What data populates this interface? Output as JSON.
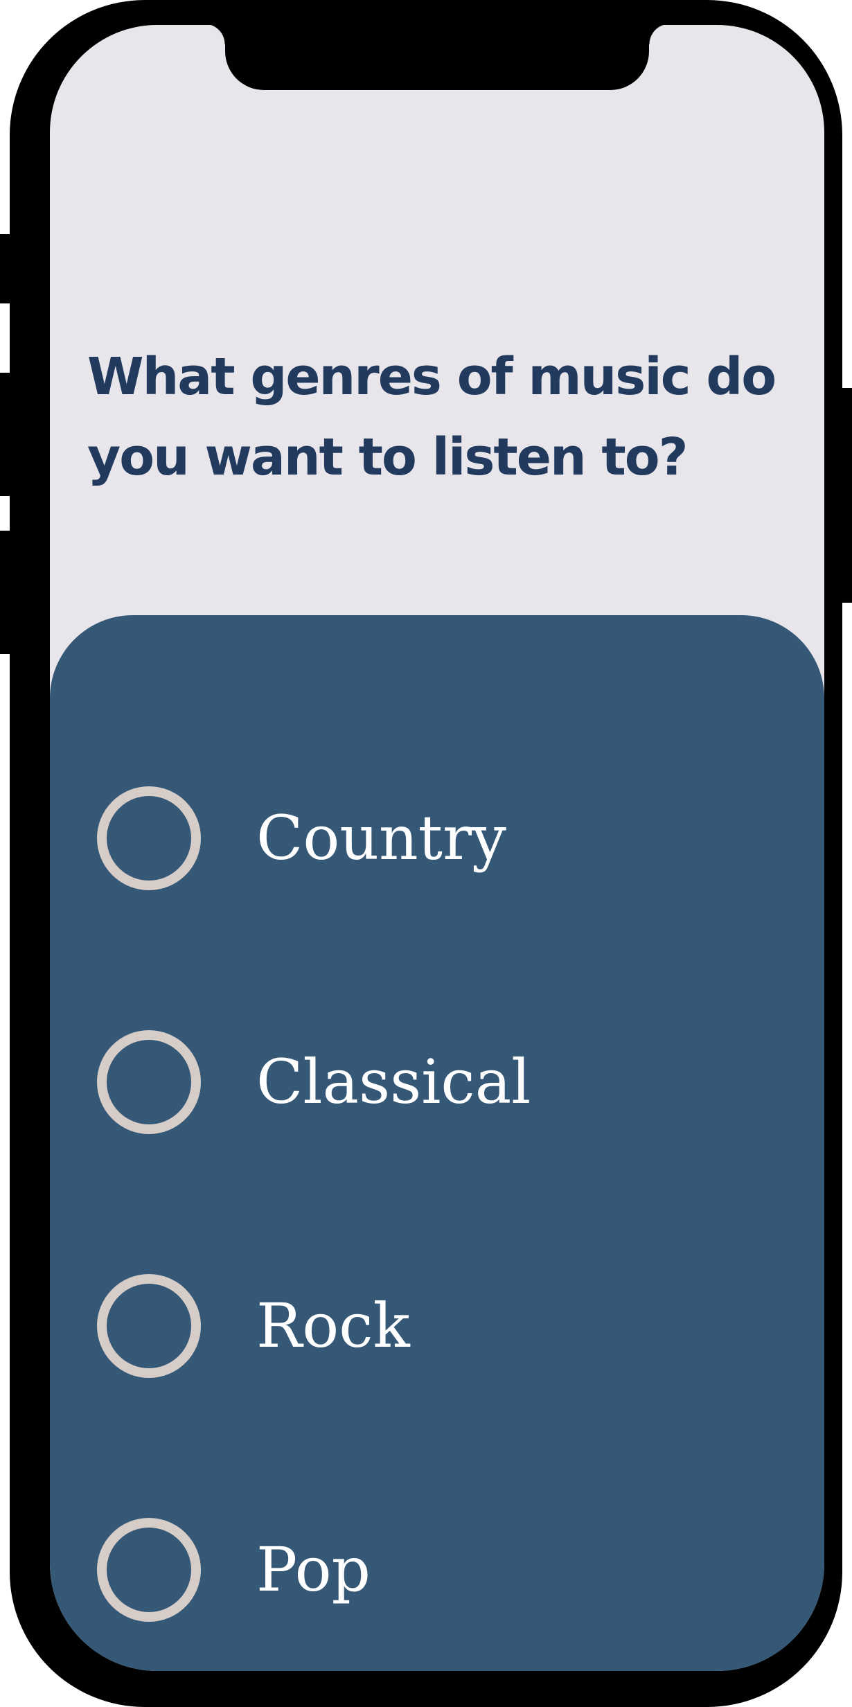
{
  "survey": {
    "question": "What genres of music do you want to listen to?",
    "options": [
      {
        "label": "Country",
        "selected": false
      },
      {
        "label": "Classical",
        "selected": false
      },
      {
        "label": "Rock",
        "selected": false
      },
      {
        "label": "Pop",
        "selected": false
      }
    ]
  },
  "icons": {
    "radio_unselected": "radio-unselected-icon"
  },
  "colors": {
    "screen_background": "#e8e6eb",
    "panel_background": "#365877",
    "question_text": "#213a5e",
    "option_text": "#ffffff",
    "radio_ring": "#d7cdc8",
    "device_frame": "#000000"
  }
}
